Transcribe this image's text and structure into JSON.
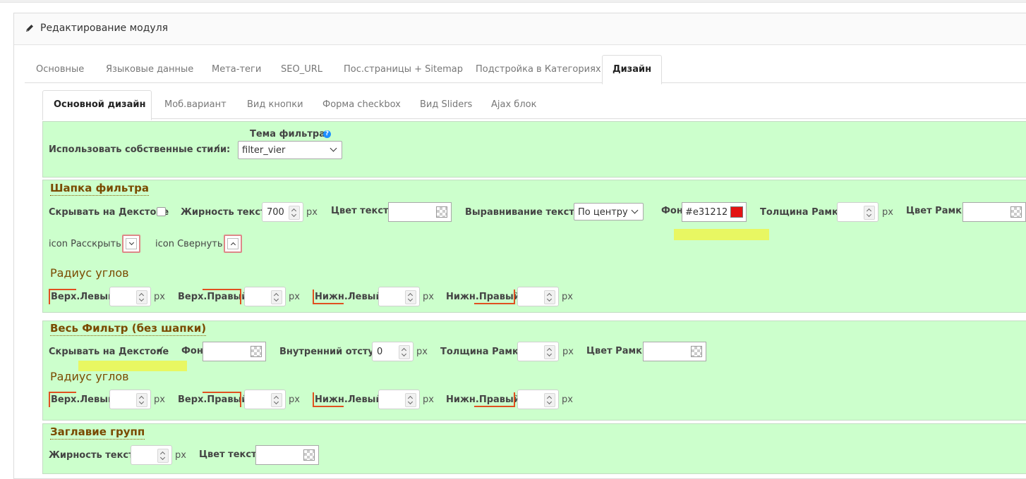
{
  "panel": {
    "title": "Редактирование модуля"
  },
  "tabs": [
    "Основные",
    "Языковые данные",
    "Мета-теги",
    "SEO_URL",
    "Пос.страницы + Sitemap",
    "Подстройка в Категориях",
    "Дизайн"
  ],
  "subtabs": [
    "Основной дизайн",
    "Моб.вариант",
    "Вид кнопки",
    "Форма checkbox",
    "Вид Sliders",
    "Ajax блок"
  ],
  "general": {
    "use_styles_label": "Использовать собственные стили:",
    "use_styles_checked": true,
    "theme_label": "Тема фильтра:",
    "theme_value": "filter_vier"
  },
  "header_section": {
    "title": "Шапка фильтра",
    "hide_desktop_label": "Скрывать на Декстопе",
    "hide_desktop_checked": false,
    "font_weight_label": "Жирность текста",
    "font_weight_value": "700",
    "text_color_label": "Цвет текста",
    "align_label": "Выравнивание текста",
    "align_value": "По центру",
    "bg_label": "Фон",
    "bg_value": "#e31212",
    "bg_swatch": "#e31212",
    "border_width_label": "Толщина Рамки",
    "border_color_label": "Цвет Рамки",
    "icon_expand_label": "icon Расскрыть",
    "icon_collapse_label": "icon Свернуть",
    "radius_title": "Радиус углов",
    "radius": {
      "tl": "Верх.Левый",
      "tr": "Верх.Правый",
      "bl": "Нижн.Левый",
      "br": "Нижн.Правый"
    }
  },
  "whole_section": {
    "title": "Весь Фильтр (без шапки)",
    "hide_desktop_label": "Скрывать на Декстопе",
    "hide_desktop_checked": true,
    "bg_label": "Фон",
    "padding_label": "Внутренний отступ",
    "padding_value": "0",
    "border_width_label": "Толщина Рамки",
    "border_color_label": "Цвет Рамки",
    "radius_title": "Радиус углов",
    "radius": {
      "tl": "Верх.Левый",
      "tr": "Верх.Правый",
      "bl": "Нижн.Левый",
      "br": "Нижн.Правый"
    }
  },
  "groups_section": {
    "title": "Заглавие групп",
    "font_weight_label": "Жирность текста",
    "text_color_label": "Цвет текста"
  },
  "units": {
    "px": "px"
  },
  "icons": {
    "edit": "pencil-icon",
    "help": "help-icon",
    "expand": "chevron-down-icon",
    "collapse": "chevron-up-icon"
  },
  "colors": {
    "section_bg": "#ccffcc",
    "highlight": "#e8f762",
    "accent_border": "#e05020",
    "section_title": "#7a4a00"
  }
}
